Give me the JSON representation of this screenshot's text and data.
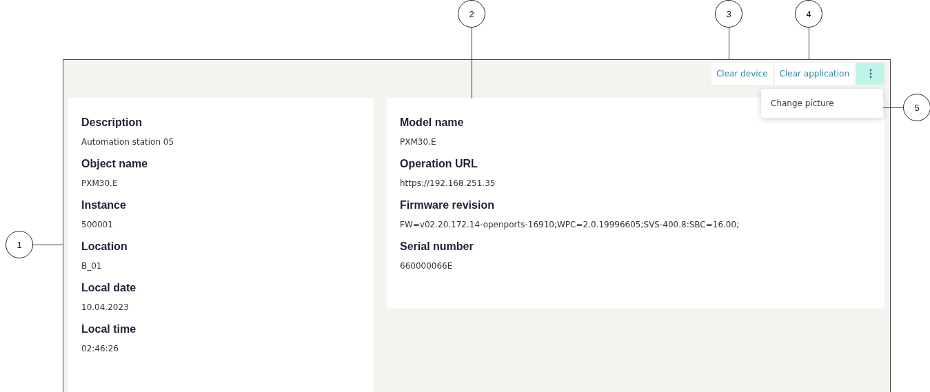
{
  "toolbar": {
    "buttons": [
      {
        "label": "Clear device"
      },
      {
        "label": "Clear application"
      }
    ],
    "more_menu_open": true
  },
  "menu": {
    "items": [
      {
        "label": "Change picture"
      }
    ]
  },
  "cards": [
    {
      "fields": [
        {
          "label": "Description",
          "value": "Automation station 05"
        },
        {
          "label": "Object name",
          "value": "PXM30.E"
        },
        {
          "label": "Instance",
          "value": "500001"
        },
        {
          "label": "Location",
          "value": "B_01"
        },
        {
          "label": "Local date",
          "value": "10.04.2023"
        },
        {
          "label": "Local time",
          "value": "02:46:26"
        }
      ]
    },
    {
      "fields": [
        {
          "label": "Model name",
          "value": "PXM30.E"
        },
        {
          "label": "Operation URL",
          "value": "https://192.168.251.35"
        },
        {
          "label": "Firmware revision",
          "value": "FW=v02.20.172.14-openports-16910;WPC=2.0.19996605;SVS-400.8:SBC=16.00;"
        },
        {
          "label": "Serial number",
          "value": "660000066E"
        }
      ]
    }
  ],
  "callouts": [
    {
      "number": "1"
    },
    {
      "number": "2"
    },
    {
      "number": "3"
    },
    {
      "number": "4"
    },
    {
      "number": "5"
    }
  ]
}
